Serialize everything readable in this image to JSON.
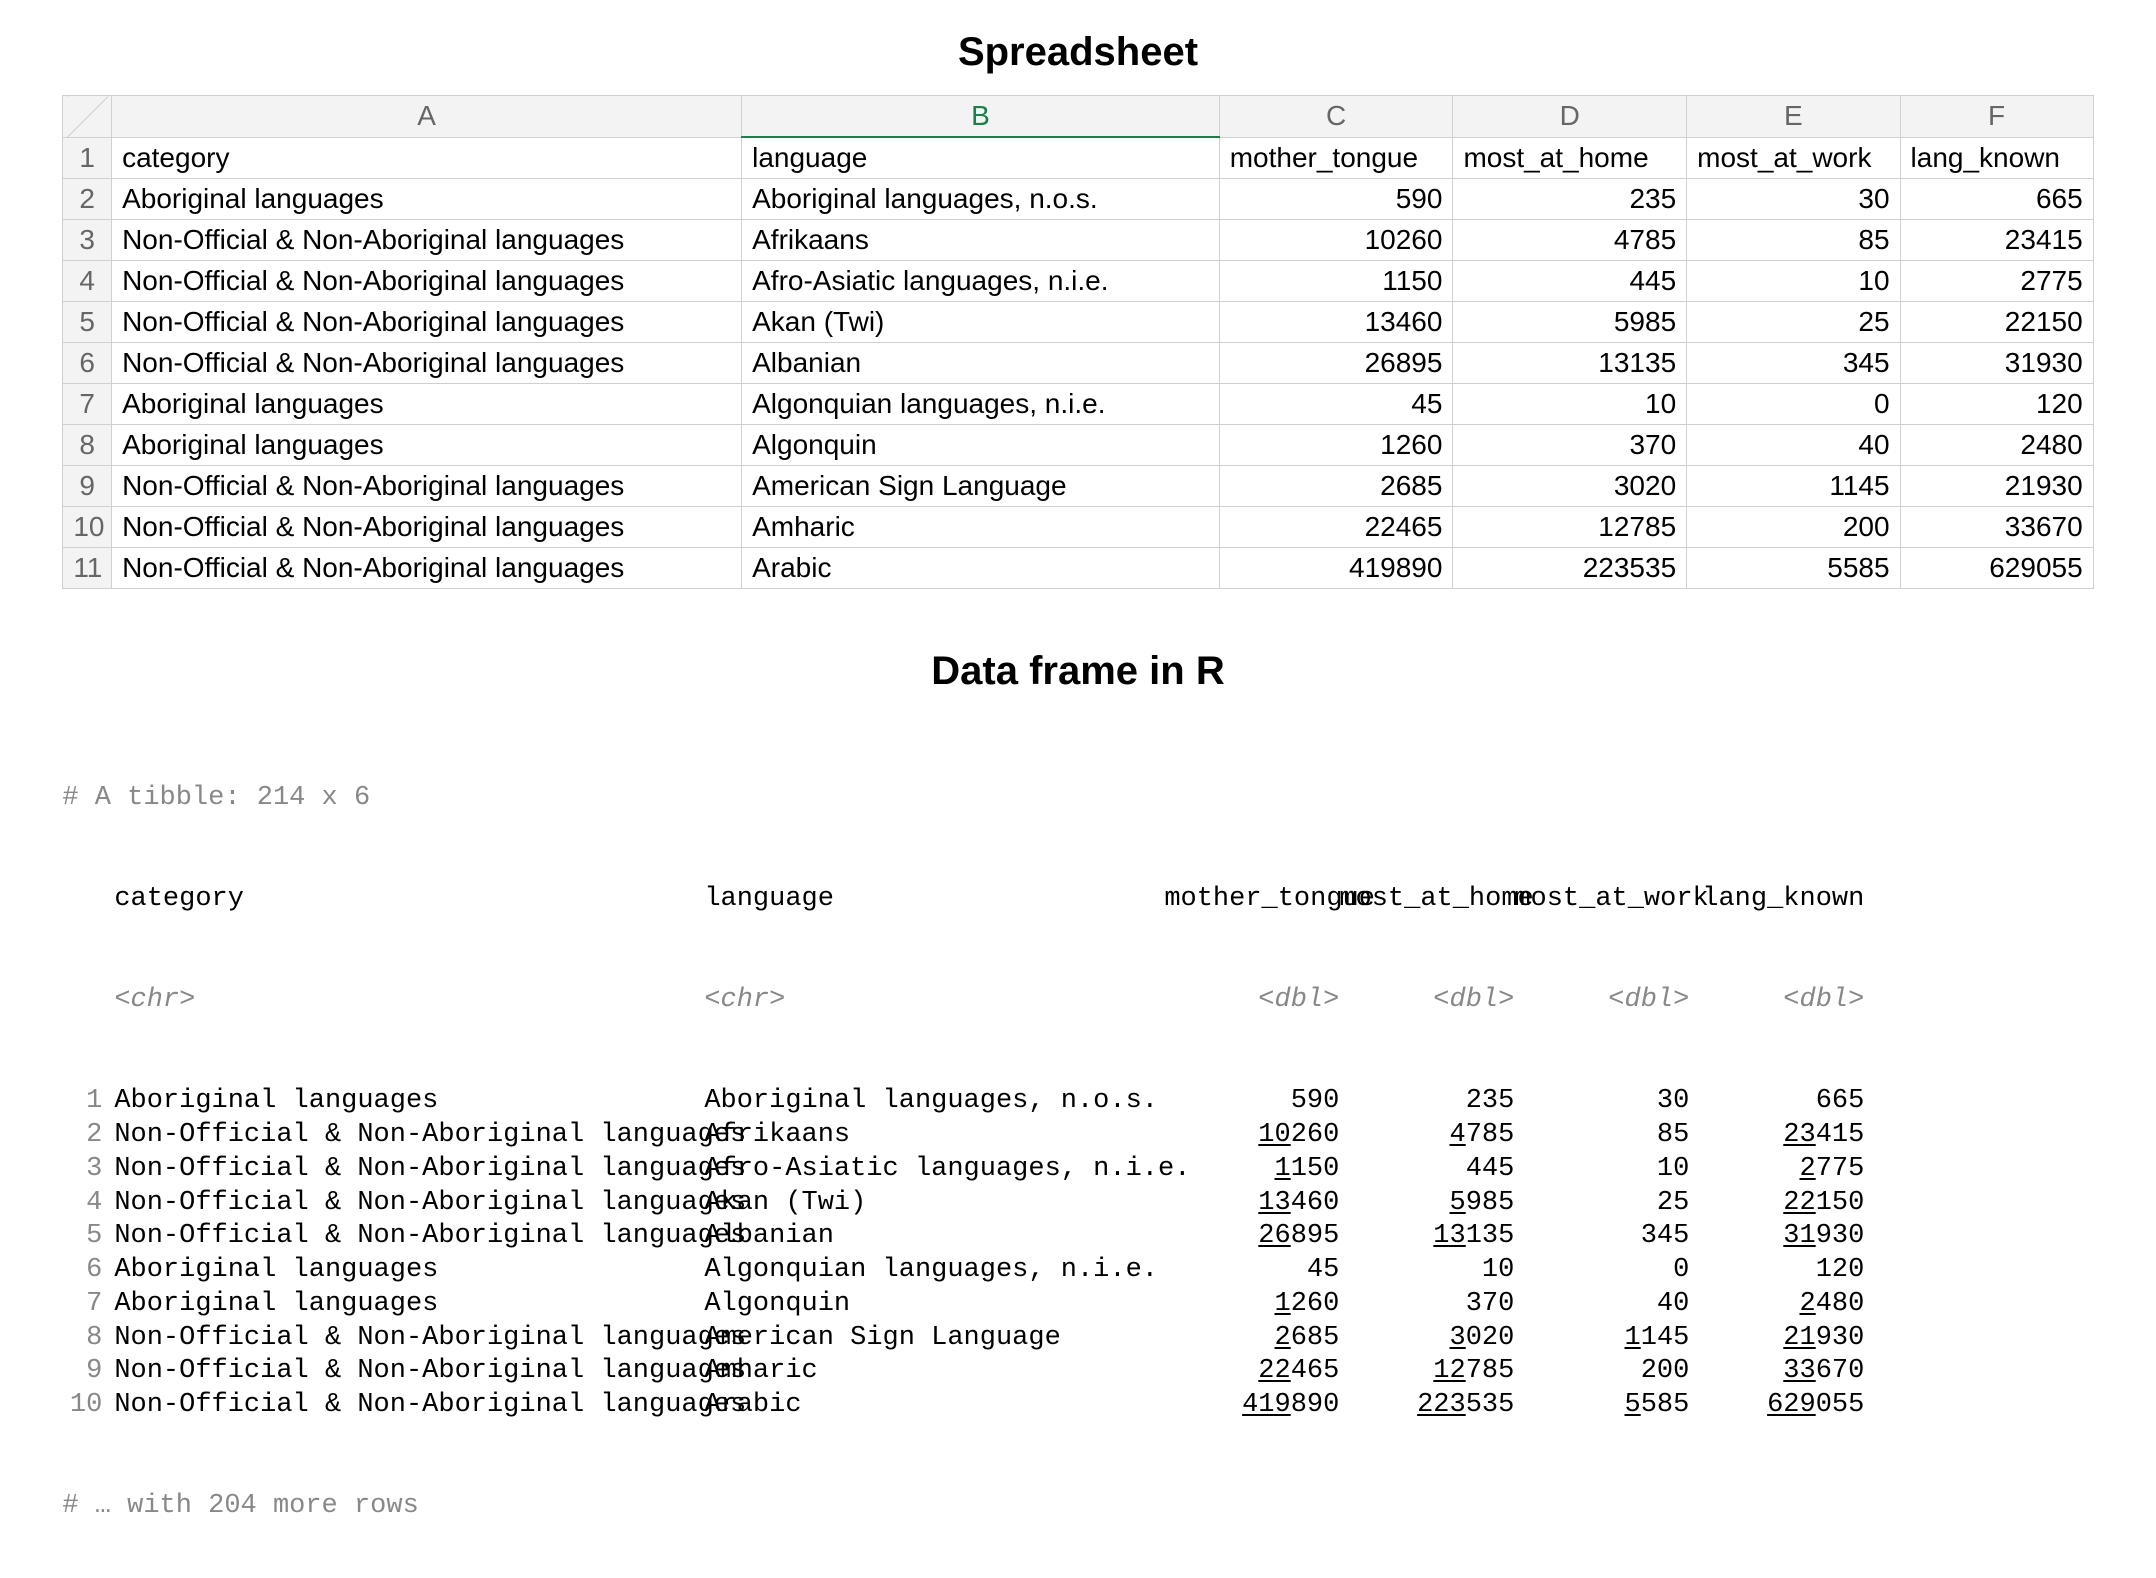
{
  "titles": {
    "spreadsheet": "Spreadsheet",
    "tibble": "Data frame in R"
  },
  "spreadsheet": {
    "col_letters": [
      "A",
      "B",
      "C",
      "D",
      "E",
      "F"
    ],
    "selected_col": "B",
    "headers": [
      "category",
      "language",
      "mother_tongue",
      "most_at_home",
      "most_at_work",
      "lang_known"
    ],
    "rows": [
      {
        "n": 1,
        "category": "Aboriginal languages",
        "language": "Aboriginal languages, n.o.s.",
        "mother_tongue": 590,
        "most_at_home": 235,
        "most_at_work": 30,
        "lang_known": 665
      },
      {
        "n": 2,
        "category": "Non-Official & Non-Aboriginal languages",
        "language": "Afrikaans",
        "mother_tongue": 10260,
        "most_at_home": 4785,
        "most_at_work": 85,
        "lang_known": 23415
      },
      {
        "n": 3,
        "category": "Non-Official & Non-Aboriginal languages",
        "language": "Afro-Asiatic languages, n.i.e.",
        "mother_tongue": 1150,
        "most_at_home": 445,
        "most_at_work": 10,
        "lang_known": 2775
      },
      {
        "n": 4,
        "category": "Non-Official & Non-Aboriginal languages",
        "language": "Akan (Twi)",
        "mother_tongue": 13460,
        "most_at_home": 5985,
        "most_at_work": 25,
        "lang_known": 22150
      },
      {
        "n": 5,
        "category": "Non-Official & Non-Aboriginal languages",
        "language": "Albanian",
        "mother_tongue": 26895,
        "most_at_home": 13135,
        "most_at_work": 345,
        "lang_known": 31930
      },
      {
        "n": 6,
        "category": "Aboriginal languages",
        "language": "Algonquian languages, n.i.e.",
        "mother_tongue": 45,
        "most_at_home": 10,
        "most_at_work": 0,
        "lang_known": 120
      },
      {
        "n": 7,
        "category": "Aboriginal languages",
        "language": "Algonquin",
        "mother_tongue": 1260,
        "most_at_home": 370,
        "most_at_work": 40,
        "lang_known": 2480
      },
      {
        "n": 8,
        "category": "Non-Official & Non-Aboriginal languages",
        "language": "American Sign Language",
        "mother_tongue": 2685,
        "most_at_home": 3020,
        "most_at_work": 1145,
        "lang_known": 21930
      },
      {
        "n": 9,
        "category": "Non-Official & Non-Aboriginal languages",
        "language": "Amharic",
        "mother_tongue": 22465,
        "most_at_home": 12785,
        "most_at_work": 200,
        "lang_known": 33670
      },
      {
        "n": 10,
        "category": "Non-Official & Non-Aboriginal languages",
        "language": "Arabic",
        "mother_tongue": 419890,
        "most_at_home": 223535,
        "most_at_work": 5585,
        "lang_known": 629055
      }
    ]
  },
  "tibble": {
    "dim_text": "# A tibble: 214 x 6",
    "headers": [
      "category",
      "language",
      "mother_tongue",
      "most_at_home",
      "most_at_work",
      "lang_known"
    ],
    "types": [
      "<chr>",
      "<chr>",
      "<dbl>",
      "<dbl>",
      "<dbl>",
      "<dbl>"
    ],
    "rows": [
      {
        "n": 1,
        "category": "Aboriginal languages",
        "language": "Aboriginal languages, n.o.s.",
        "mother_tongue": 590,
        "most_at_home": 235,
        "most_at_work": 30,
        "lang_known": 665
      },
      {
        "n": 2,
        "category": "Non-Official & Non-Aboriginal languages",
        "language": "Afrikaans",
        "mother_tongue": 10260,
        "most_at_home": 4785,
        "most_at_work": 85,
        "lang_known": 23415
      },
      {
        "n": 3,
        "category": "Non-Official & Non-Aboriginal languages",
        "language": "Afro-Asiatic languages, n.i.e.",
        "mother_tongue": 1150,
        "most_at_home": 445,
        "most_at_work": 10,
        "lang_known": 2775
      },
      {
        "n": 4,
        "category": "Non-Official & Non-Aboriginal languages",
        "language": "Akan (Twi)",
        "mother_tongue": 13460,
        "most_at_home": 5985,
        "most_at_work": 25,
        "lang_known": 22150
      },
      {
        "n": 5,
        "category": "Non-Official & Non-Aboriginal languages",
        "language": "Albanian",
        "mother_tongue": 26895,
        "most_at_home": 13135,
        "most_at_work": 345,
        "lang_known": 31930
      },
      {
        "n": 6,
        "category": "Aboriginal languages",
        "language": "Algonquian languages, n.i.e.",
        "mother_tongue": 45,
        "most_at_home": 10,
        "most_at_work": 0,
        "lang_known": 120
      },
      {
        "n": 7,
        "category": "Aboriginal languages",
        "language": "Algonquin",
        "mother_tongue": 1260,
        "most_at_home": 370,
        "most_at_work": 40,
        "lang_known": 2480
      },
      {
        "n": 8,
        "category": "Non-Official & Non-Aboriginal languages",
        "language": "American Sign Language",
        "mother_tongue": 2685,
        "most_at_home": 3020,
        "most_at_work": 1145,
        "lang_known": 21930
      },
      {
        "n": 9,
        "category": "Non-Official & Non-Aboriginal languages",
        "language": "Amharic",
        "mother_tongue": 22465,
        "most_at_home": 12785,
        "most_at_work": 200,
        "lang_known": 33670
      },
      {
        "n": 10,
        "category": "Non-Official & Non-Aboriginal languages",
        "language": "Arabic",
        "mother_tongue": 419890,
        "most_at_home": 223535,
        "most_at_work": 5585,
        "lang_known": 629055
      }
    ],
    "footer": "# … with 204 more rows"
  }
}
